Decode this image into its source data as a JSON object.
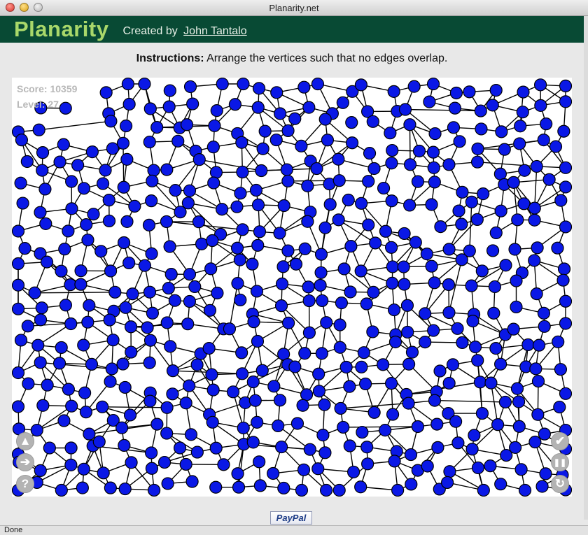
{
  "window": {
    "title": "Planarity.net"
  },
  "header": {
    "logo": "Planarity",
    "credit_prefix": "Created by",
    "author_link": "John Tantalo",
    "background": "#084a34",
    "logo_color": "#a9d86a"
  },
  "instructions": {
    "label": "Instructions:",
    "text": "Arrange the vertices such that no edges overlap."
  },
  "game": {
    "score_label": "Score:",
    "score_value": "10359",
    "level_label": "Level:",
    "level_value": "27",
    "vertex_color": "#0a18e6",
    "edge_color": "#000000",
    "controls_left": [
      {
        "name": "up-arrow-icon",
        "glyph": "▲"
      },
      {
        "name": "right-arrow-icon",
        "glyph": "➔"
      },
      {
        "name": "help-icon",
        "glyph": "?"
      }
    ],
    "controls_right": [
      {
        "name": "checkmark-icon",
        "glyph": "✔"
      },
      {
        "name": "pause-icon",
        "glyph": "❚❚"
      },
      {
        "name": "refresh-icon",
        "glyph": "↻"
      }
    ]
  },
  "footer": {
    "paypal_label": "PayPal"
  },
  "status": {
    "text": "Done"
  }
}
